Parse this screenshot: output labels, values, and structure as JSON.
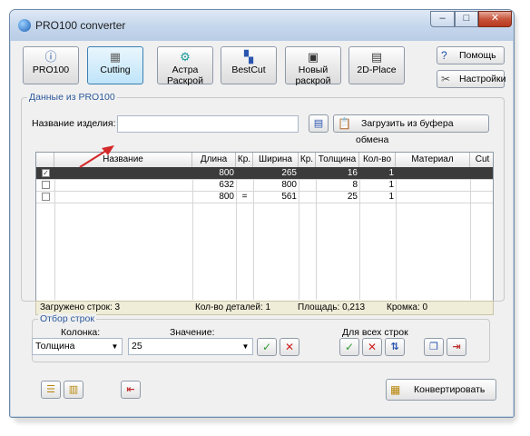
{
  "window": {
    "title": "PRO100 converter",
    "minimize": "–",
    "maximize": "□",
    "close": "✕"
  },
  "toolbar": [
    {
      "label": "PRO100",
      "icon": "info-circle-icon",
      "glyph": "ⓘ"
    },
    {
      "label": "Cutting",
      "icon": "cutting-icon",
      "glyph": "▦"
    },
    {
      "label": "Астра\nРаскрой",
      "icon": "gear-icon",
      "glyph": "⚙"
    },
    {
      "label": "BestCut",
      "icon": "bestcut-icon",
      "glyph": "▚"
    },
    {
      "label": "Новый\nраскрой",
      "icon": "new-cut-icon",
      "glyph": "▣"
    },
    {
      "label": "2D-Place",
      "icon": "2d-place-icon",
      "glyph": "▤"
    }
  ],
  "side_buttons": {
    "help": "Помощь",
    "settings": "Настройки"
  },
  "data_group": {
    "title": "Данные из PRO100",
    "name_label": "Название изделия:",
    "name_value": "",
    "load_button": "Загрузить из буфера обмена"
  },
  "table": {
    "columns": [
      "",
      "Название",
      "Длина",
      "Кр.",
      "Ширина",
      "Кр.",
      "Толщина",
      "Кол-во",
      "Материал",
      "Cut"
    ],
    "rows": [
      {
        "checked": true,
        "name": "",
        "length": "800",
        "kr1": "",
        "width": "265",
        "kr2": "",
        "thickness": "16",
        "qty": "1",
        "material": "",
        "cut": ""
      },
      {
        "checked": false,
        "name": "",
        "length": "632",
        "kr1": "",
        "width": "800",
        "kr2": "",
        "thickness": "8",
        "qty": "1",
        "material": "",
        "cut": ""
      },
      {
        "checked": false,
        "name": "",
        "length": "800",
        "kr1": "=",
        "width": "561",
        "kr2": "",
        "thickness": "25",
        "qty": "1",
        "material": "",
        "cut": ""
      }
    ]
  },
  "status": {
    "rows_loaded": "Загружено строк: 3",
    "parts_count": "Кол-во деталей: 1",
    "area": "Площадь: 0,213",
    "edge": "Кромка: 0"
  },
  "filter_group": {
    "title": "Отбор строк",
    "column_label": "Колонка:",
    "column_value": "Толщина",
    "value_label": "Значение:",
    "value_value": "25",
    "all_rows_label": "Для всех строк"
  },
  "convert_button": "Конвертировать",
  "colors": {
    "selected_row": "#3b3b3b",
    "status_bg": "#efedd8",
    "group_title": "#2d5a9c"
  }
}
